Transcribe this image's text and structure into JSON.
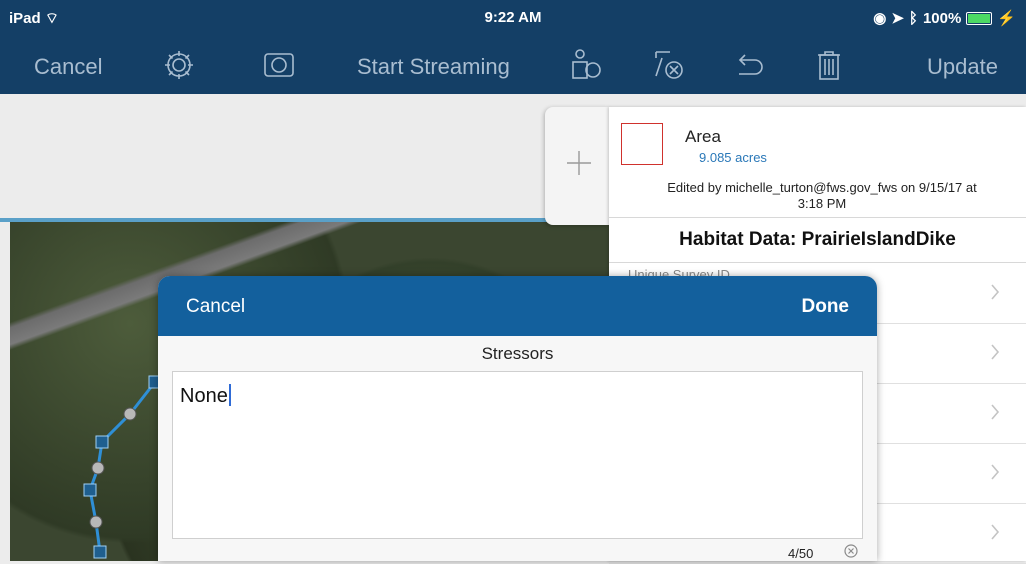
{
  "status_bar": {
    "device": "iPad",
    "time": "9:22 AM",
    "battery": "100%",
    "battery_level": 1.0
  },
  "toolbar": {
    "cancel_label": "Cancel",
    "start_streaming_label": "Start Streaming",
    "update_label": "Update",
    "icons": [
      "gear-icon",
      "camera-icon",
      "collect-vertex-icon",
      "clear-selection-icon",
      "undo-icon",
      "trash-icon"
    ]
  },
  "feature_panel": {
    "geometry_type": "Area",
    "area_value": "9.085 acres",
    "edited_by_line1": "Edited by michelle_turton@fws.gov_fws on 9/15/17 at",
    "edited_by_line2": "3:18 PM",
    "layer_title": "Habitat Data: PrairieIslandDike",
    "rows": [
      {
        "label": "Unique Survey ID"
      },
      {
        "label": ""
      },
      {
        "label": ""
      },
      {
        "label": ""
      },
      {
        "label": ""
      }
    ]
  },
  "editor_modal": {
    "cancel_label": "Cancel",
    "done_label": "Done",
    "field_title": "Stressors",
    "value": "None",
    "counter": "4/50"
  },
  "colors": {
    "bar": "#143f66",
    "modal_header": "#13609d",
    "accent_text": "#2a78b8",
    "swatch_border": "#d0322d"
  }
}
